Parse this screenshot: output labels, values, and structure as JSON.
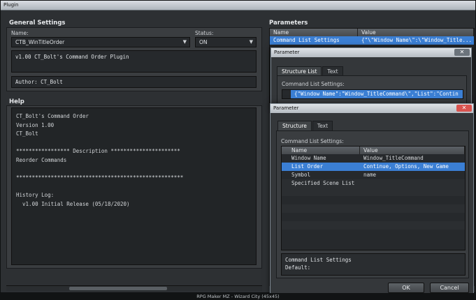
{
  "window": {
    "title": "Plugin"
  },
  "general": {
    "title": "General Settings",
    "name_label": "Name:",
    "name_value": "CTB_WinTitleOrder",
    "status_label": "Status:",
    "status_value": "ON",
    "description": "v1.00 CT_Bolt's Command Order Plugin",
    "author": "Author: CT_Bolt"
  },
  "help": {
    "title": "Help",
    "lines": [
      "CT_Bolt's Command Order",
      "Version 1.00",
      "CT_Bolt",
      "",
      "***************** Description **********************",
      "Reorder Commands",
      "",
      "*****************************************************",
      "",
      "History Log:",
      "  v1.00 Initial Release (05/18/2020)"
    ]
  },
  "parameters": {
    "title": "Parameters",
    "columns": [
      "Name",
      "Value"
    ],
    "rows": [
      {
        "name": "Command List Settings",
        "value": "{\"\\\"Window Name\\\":\\\"Window_Title..."
      }
    ]
  },
  "dialog1": {
    "title": "Parameter",
    "tabs": [
      "Structure List",
      "Text"
    ],
    "field_label": "Command List Settings:",
    "row_value": "{\"Window Name\":\"Window_TitleCommand\\\",\"List\":\"Contin"
  },
  "dialog2": {
    "title": "Parameter",
    "tabs": [
      "Structure",
      "Text"
    ],
    "field_label": "Command List Settings:",
    "columns": [
      "Name",
      "Value"
    ],
    "rows": [
      {
        "name": "Window Name",
        "value": "Window_TitleCommand"
      },
      {
        "name": "List Order",
        "value": "Continue, Options, New Game"
      },
      {
        "name": "Symbol",
        "value": "name"
      },
      {
        "name": "Specified Scene List",
        "value": ""
      }
    ],
    "desc_title": "Command List Settings",
    "desc_default": "Default:",
    "ok": "OK",
    "cancel": "Cancel"
  },
  "status_bar": "RPG Maker MZ - Wizard City (45x45)",
  "colors": {
    "selection": "#3b7fd4",
    "close": "#d9534f"
  }
}
